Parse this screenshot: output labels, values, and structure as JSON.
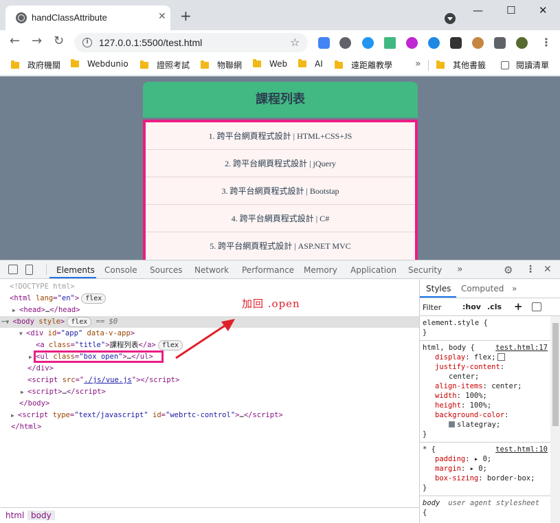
{
  "browser": {
    "tab_title": "handClassAttribute",
    "tab_close": "✕",
    "new_tab": "+",
    "window": {
      "minimize": "—",
      "maximize": "☐",
      "close": "✕"
    },
    "nav": {
      "back": "←",
      "forward": "→",
      "reload": "↻"
    },
    "url": "127.0.0.1:5500/test.html",
    "star": "☆",
    "menu": "⋮"
  },
  "bookmarks": {
    "items": [
      "政府機關",
      "Webdunio",
      "證照考試",
      "物聯網",
      "Web",
      "AI",
      "遠距離教學"
    ],
    "more": "»",
    "other": "其他書籤",
    "reading_list": "閱讀清單"
  },
  "page": {
    "title": "課程列表",
    "courses": [
      "1. 跨平台網頁程式設計 | HTML+CSS+JS",
      "2. 跨平台網頁程式設計 | jQuery",
      "3. 跨平台網頁程式設計 | Bootstap",
      "4. 跨平台網頁程式設計 | C#",
      "5. 跨平台網頁程式設計 | ASP.NET MVC"
    ],
    "colors": {
      "background": "#708090",
      "title_bg": "#42b983",
      "highlight": "#e91e84"
    }
  },
  "devtools": {
    "tabs": [
      "Elements",
      "Console",
      "Sources",
      "Network",
      "Performance",
      "Memory",
      "Application",
      "Security"
    ],
    "more_tabs": "»",
    "close": "✕",
    "annotation": "加回 .open",
    "dom": {
      "doctype": "<!DOCTYPE html>",
      "html_open": "html",
      "html_lang_attr": "lang",
      "html_lang_val": "\"en\"",
      "flex": "flex",
      "head": "head",
      "body": "body",
      "body_style_attr": "style",
      "eq0": "== $0",
      "div": "div",
      "id_attr": "id",
      "id_val": "\"app\"",
      "vapp_attr": "data-v-app",
      "a_tag": "a",
      "class_attr": "class",
      "a_class_val": "\"title\"",
      "a_text": "課程列表",
      "ul_tag": "ul",
      "ul_class_val": "\"box open\"",
      "script": "script",
      "src_attr": "src",
      "src_val": "./js/vue.js",
      "type_attr": "type",
      "type_val": "\"text/javascript\"",
      "webrtc_val": "\"webrtc-control\"",
      "ellipsis": "…"
    },
    "breadcrumbs": [
      "html",
      "body"
    ],
    "styles": {
      "tabs": [
        "Styles",
        "Computed"
      ],
      "more": "»",
      "filter_placeholder": "Filter",
      "hov": ":hov",
      "cls": ".cls",
      "plus": "+",
      "rules": [
        {
          "selector": "element.style {",
          "source": "",
          "decls": []
        },
        {
          "selector": "html, body {",
          "source": "test.html:17",
          "decls": [
            [
              "display",
              "flex;"
            ],
            [
              "justify-content",
              ""
            ],
            [
              "",
              "center;"
            ],
            [
              "align-items",
              "center;"
            ],
            [
              "width",
              "100%;"
            ],
            [
              "height",
              "100%;"
            ],
            [
              "background-color",
              ""
            ],
            [
              "",
              "slategray;"
            ]
          ]
        },
        {
          "selector": "* {",
          "source": "test.html:10",
          "decls": [
            [
              "padding",
              "0;"
            ],
            [
              "margin",
              "0;"
            ],
            [
              "box-sizing",
              "border-box;"
            ]
          ]
        },
        {
          "selector": "body",
          "source": "user agent stylesheet",
          "decls": []
        }
      ],
      "close_brace": "}",
      "open_brace": "{"
    }
  }
}
